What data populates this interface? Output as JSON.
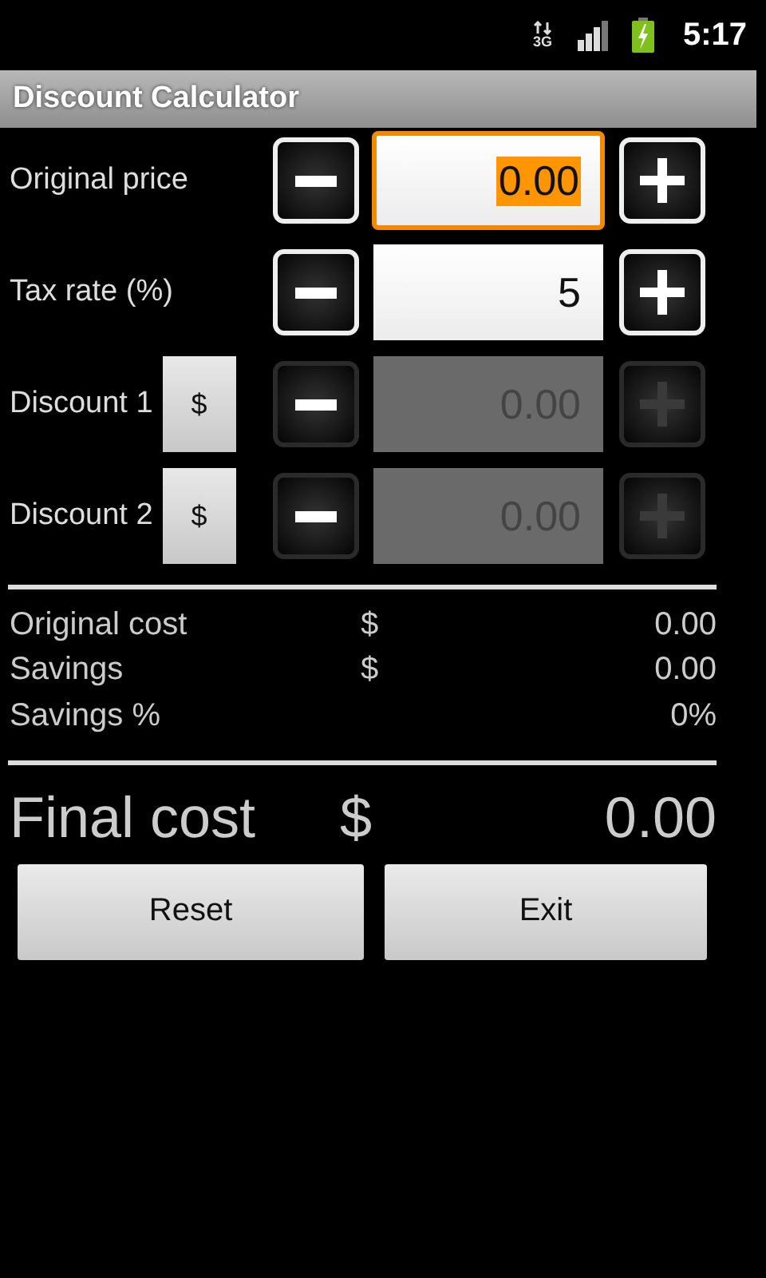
{
  "status_bar": {
    "network_type": "3G",
    "time": "5:17"
  },
  "window": {
    "title": "Discount Calculator"
  },
  "inputs": [
    {
      "label": "Original price",
      "value": "0.00",
      "focused": true,
      "disabled": false
    },
    {
      "label": "Tax rate (%)",
      "value": "5",
      "focused": false,
      "disabled": false
    },
    {
      "label": "Discount 1",
      "unit": "$",
      "value": "0.00",
      "focused": false,
      "disabled": true
    },
    {
      "label": "Discount 2",
      "unit": "$",
      "value": "0.00",
      "focused": false,
      "disabled": true
    }
  ],
  "summary": [
    {
      "label": "Original cost",
      "currency": "$",
      "value": "0.00"
    },
    {
      "label": "Savings",
      "currency": "$",
      "value": "0.00"
    },
    {
      "label": "Savings %",
      "value": "0%"
    }
  ],
  "final": {
    "label": "Final cost",
    "currency": "$",
    "value": "0.00"
  },
  "buttons": [
    "Reset",
    "Exit"
  ]
}
